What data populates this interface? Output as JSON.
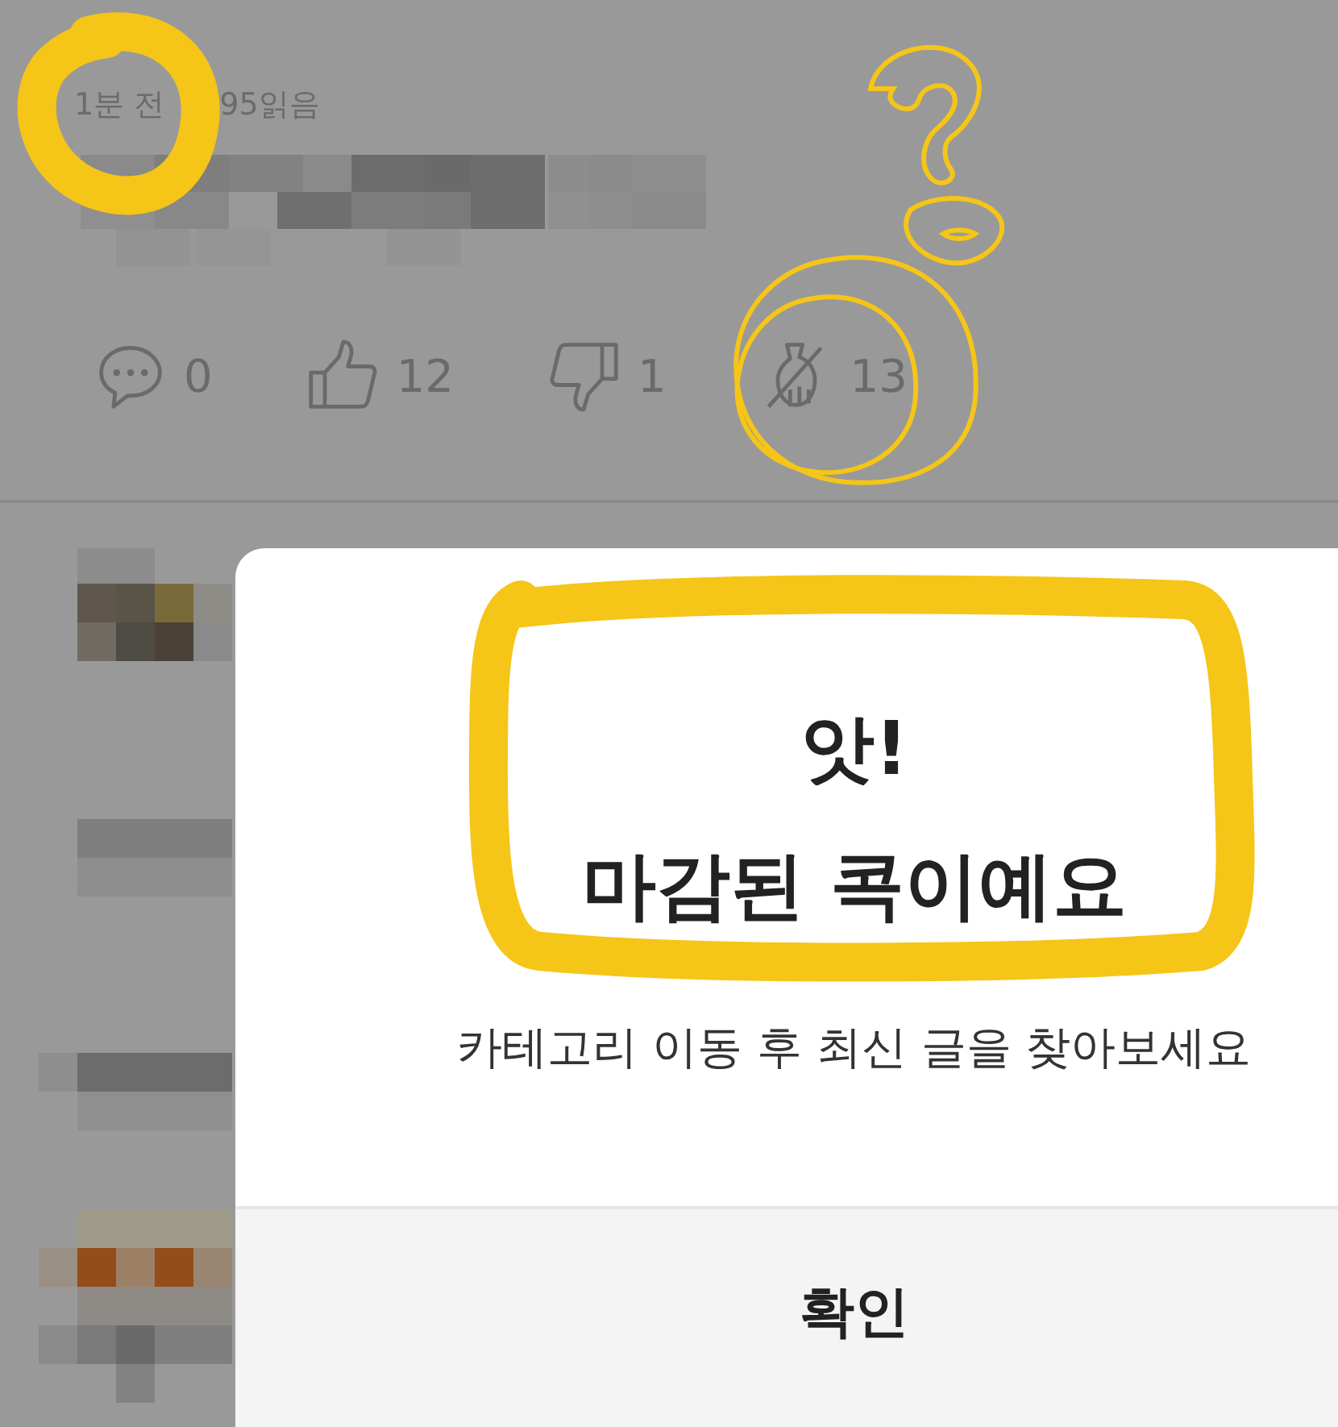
{
  "post": {
    "meta": [
      "1분 전",
      "95읽음"
    ],
    "actions": [
      {
        "kind": "comment",
        "count": "0"
      },
      {
        "kind": "like",
        "count": "12"
      },
      {
        "kind": "dislike",
        "count": "1"
      },
      {
        "kind": "kok",
        "count": "13"
      }
    ]
  },
  "dialog": {
    "title_lines": [
      "앗!",
      "마감된 콕이예요"
    ],
    "message": "카테고리 이동 후 최신 글을 찾아보세요",
    "button": "확인"
  }
}
